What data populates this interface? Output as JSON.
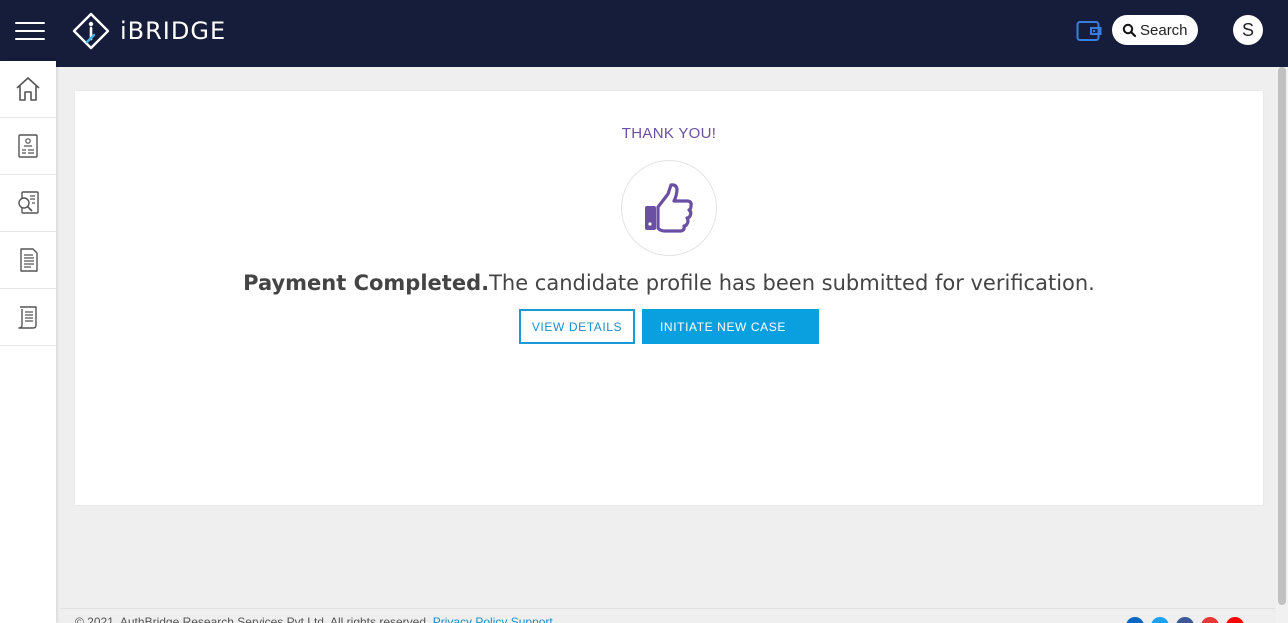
{
  "header": {
    "brand": "iBRIDGE",
    "search_label": "Search",
    "avatar_initial": "S"
  },
  "sidebar": {
    "items": [
      {
        "icon": "home-icon"
      },
      {
        "icon": "candidate-form-icon"
      },
      {
        "icon": "verification-report-icon"
      },
      {
        "icon": "document-icon"
      },
      {
        "icon": "scroll-document-icon"
      }
    ]
  },
  "main": {
    "thank_you": "THANK YOU!",
    "message_bold": "Payment Completed.",
    "message_rest": "The candidate profile has been submitted for verification.",
    "view_details_label": "VIEW DETAILS",
    "initiate_case_label": "INITIATE NEW CASE"
  },
  "footer": {
    "copyright": "© 2021, AuthBridge Research Services Pvt Ltd. All rights reserved.",
    "privacy_link": "Privacy Policy",
    "support_link": "Support"
  },
  "colors": {
    "header_bg": "#161d3a",
    "accent_purple": "#6a4fa3",
    "accent_blue": "#0aa0e0",
    "social": [
      "#0a66c2",
      "#1da1f2",
      "#3b5998",
      "#e53935",
      "#ff0000"
    ]
  }
}
